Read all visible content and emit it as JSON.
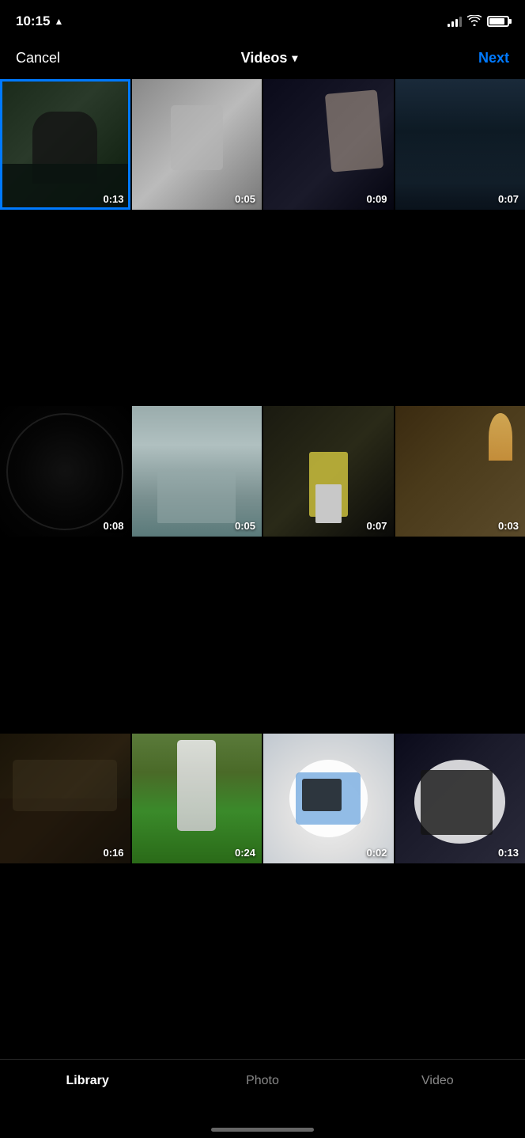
{
  "statusBar": {
    "time": "10:15",
    "locationArrow": "▶",
    "batteryFull": true
  },
  "navBar": {
    "cancelLabel": "Cancel",
    "titleLabel": "Videos",
    "chevron": "▾",
    "nextLabel": "Next"
  },
  "previewControls": {
    "cropIcon": "⌞",
    "loopIcon": "∞",
    "squareIcon": "▢"
  },
  "thumbnails": [
    {
      "id": 1,
      "duration": "0:13",
      "colorClass": "thumb-1",
      "selected": true
    },
    {
      "id": 2,
      "duration": "0:05",
      "colorClass": "thumb-2",
      "selected": false
    },
    {
      "id": 3,
      "duration": "0:09",
      "colorClass": "thumb-3",
      "selected": false
    },
    {
      "id": 4,
      "duration": "0:07",
      "colorClass": "thumb-4",
      "selected": false
    },
    {
      "id": 5,
      "duration": "0:08",
      "colorClass": "thumb-5",
      "selected": false
    },
    {
      "id": 6,
      "duration": "0:05",
      "colorClass": "thumb-6",
      "selected": false
    },
    {
      "id": 7,
      "duration": "0:07",
      "colorClass": "thumb-7",
      "selected": false
    },
    {
      "id": 8,
      "duration": "0:03",
      "colorClass": "thumb-8",
      "selected": false
    },
    {
      "id": 9,
      "duration": "0:16",
      "colorClass": "thumb-9",
      "selected": false
    },
    {
      "id": 10,
      "duration": "0:24",
      "colorClass": "thumb-10",
      "selected": false
    },
    {
      "id": 11,
      "duration": "0:02",
      "colorClass": "thumb-11",
      "selected": false
    },
    {
      "id": 12,
      "duration": "0:13",
      "colorClass": "thumb-12",
      "selected": false
    }
  ],
  "tabs": [
    {
      "id": "library",
      "label": "Library",
      "active": true
    },
    {
      "id": "photo",
      "label": "Photo",
      "active": false
    },
    {
      "id": "video",
      "label": "Video",
      "active": false
    }
  ]
}
